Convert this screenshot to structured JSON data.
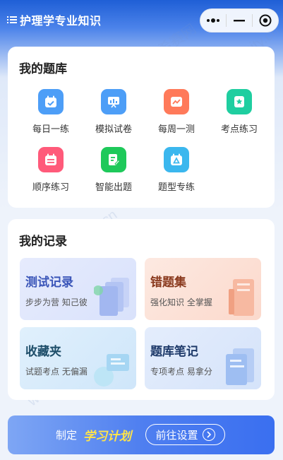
{
  "header": {
    "title": "护理学专业知识",
    "menu_icon": "list-icon",
    "capsule": {
      "more_icon": "more-dots-icon",
      "minimize_icon": "minus-icon",
      "close_icon": "target-icon"
    }
  },
  "question_bank": {
    "title": "我的题库",
    "tiles": [
      {
        "label": "每日一练",
        "icon": "calendar-check-icon",
        "color": "#4d9ef7"
      },
      {
        "label": "模拟试卷",
        "icon": "presentation-icon",
        "color": "#4d9ef7"
      },
      {
        "label": "每周一测",
        "icon": "chart-icon",
        "color": "#ff7a5a"
      },
      {
        "label": "考点练习",
        "icon": "star-badge-icon",
        "color": "#1fcea0"
      },
      {
        "label": "顺序练习",
        "icon": "calendar-list-icon",
        "color": "#ff5a7a"
      },
      {
        "label": "智能出题",
        "icon": "document-edit-icon",
        "color": "#1ec95a"
      },
      {
        "label": "题型专练",
        "icon": "triangle-calendar-icon",
        "color": "#3bb7ee"
      }
    ]
  },
  "records": {
    "title": "我的记录",
    "items": [
      {
        "title": "测试记录",
        "subtitle": "步步为营 知己彼",
        "title_color": "#3a55b8",
        "bg": "#e3e9fc"
      },
      {
        "title": "错题集",
        "subtitle": "强化知识 全掌握",
        "title_color": "#8a3a1e",
        "bg": "#fde4db"
      },
      {
        "title": "收藏夹",
        "subtitle": "试题考点 无偏漏",
        "title_color": "#1e4e6a",
        "bg": "#dcedfb"
      },
      {
        "title": "题库笔记",
        "subtitle": "专项考点 易拿分",
        "title_color": "#1e3a6a",
        "bg": "#e1ebfb"
      }
    ]
  },
  "banner": {
    "prefix": "制定",
    "highlight": "学习计划",
    "button_label": "前往设置",
    "button_icon": "chevron-right-circle-icon"
  },
  "watermark": {
    "brand": "希赛网",
    "url": "www.educity.cn"
  }
}
